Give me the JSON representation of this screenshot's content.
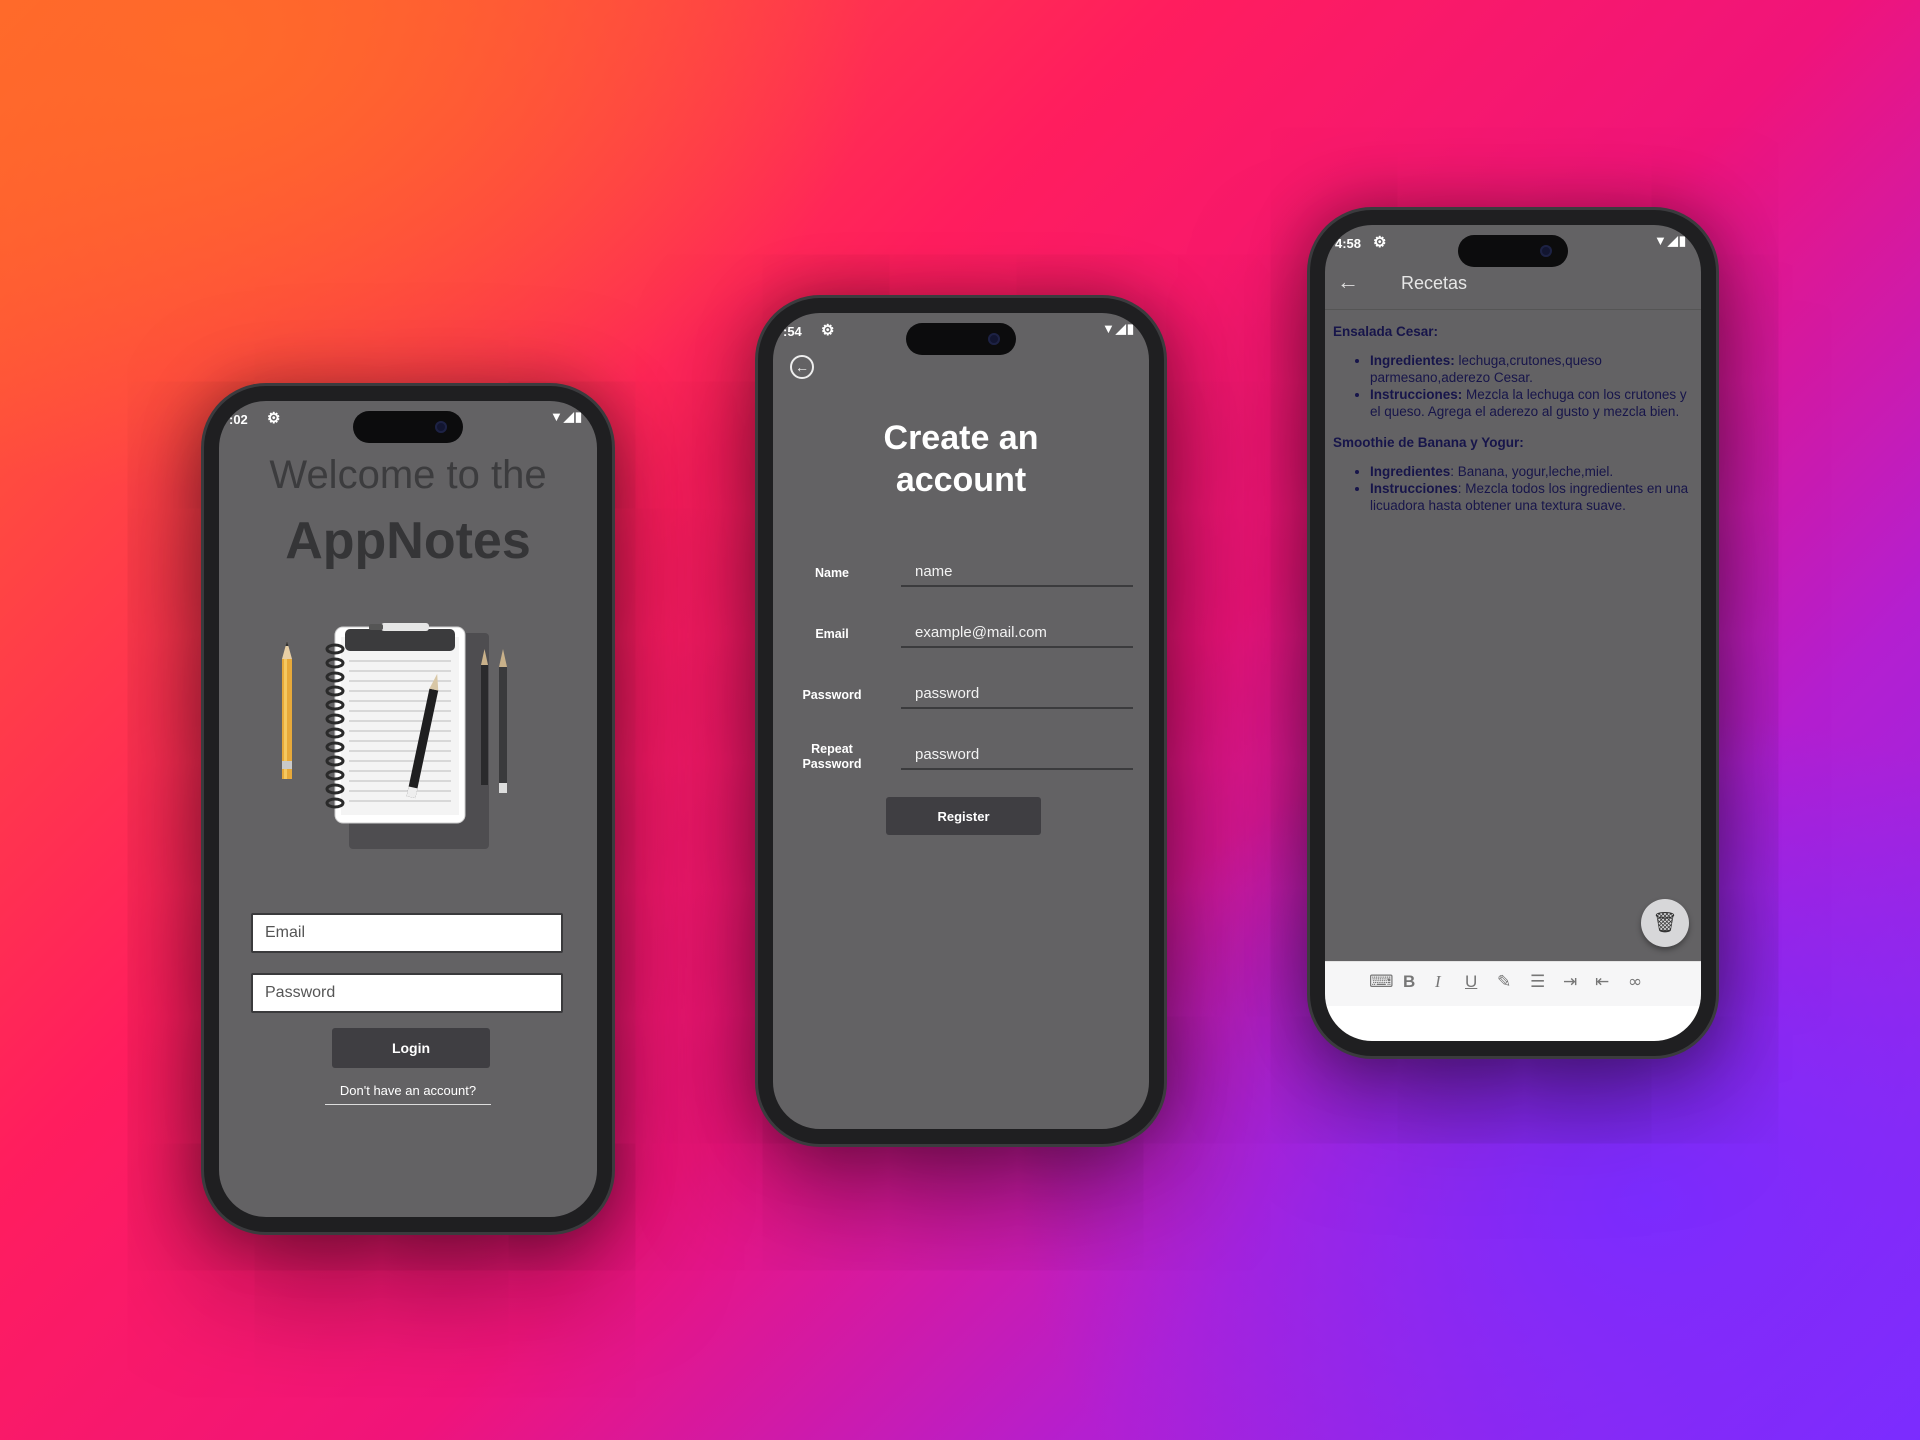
{
  "login": {
    "status_time": ":02",
    "welcome": "Welcome to the",
    "brand": "AppNotes",
    "email_placeholder": "Email",
    "password_placeholder": "Password",
    "login_label": "Login",
    "signup_link": "Don't have an account?"
  },
  "register": {
    "status_time": ":54",
    "title": "Create an account",
    "fields": [
      {
        "label": "Name",
        "placeholder": "name"
      },
      {
        "label": "Email",
        "placeholder": "example@mail.com"
      },
      {
        "label": "Password",
        "placeholder": "password"
      },
      {
        "label": "Repeat Password",
        "placeholder": "password"
      }
    ],
    "register_label": "Register"
  },
  "note": {
    "status_time": "4:58",
    "title": "Recetas",
    "recipes": [
      {
        "heading": "Ensalada Cesar:",
        "ing_label": "Ingredientes:",
        "ing_text": " lechuga,crutones,queso parmesano,aderezo Cesar.",
        "ins_label": "Instrucciones:",
        "ins_text": " Mezcla la lechuga con los crutones y el queso. Agrega el aderezo al gusto y mezcla bien."
      },
      {
        "heading": "Smoothie de Banana y Yogur:",
        "ing_label": "Ingredientes",
        "ing_text": ": Banana, yogur,leche,miel.",
        "ins_label": "Instrucciones",
        "ins_text": ": Mezcla todos los ingredientes en una licuadora hasta obtener una textura suave."
      }
    ],
    "toolbar_icons": [
      "keyboard-icon",
      "bold-icon",
      "italic-icon",
      "underline-icon",
      "clear-format-icon",
      "bullet-list-icon",
      "indent-icon",
      "outdent-icon",
      "link-icon"
    ]
  }
}
